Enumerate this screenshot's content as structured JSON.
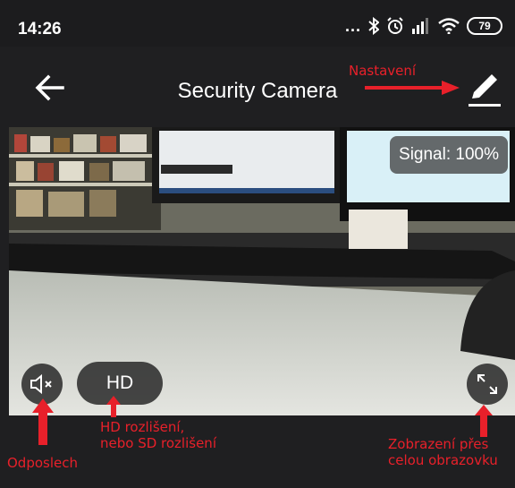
{
  "status_bar": {
    "time": "14:26",
    "dots": "...",
    "battery": "79",
    "icons": [
      "bluetooth-icon",
      "alarm-icon",
      "signal-bars-icon",
      "wifi-icon"
    ]
  },
  "header": {
    "title": "Security Camera",
    "back_icon": "arrow-left-icon",
    "edit_icon": "pencil-icon"
  },
  "video": {
    "signal_label": "Signal: 100%",
    "hd_label": "HD",
    "mute_icon": "speaker-muted-icon",
    "fullscreen_icon": "fullscreen-icon"
  },
  "annotations": {
    "settings": "Nastavení",
    "listen": "Odposlech",
    "hd_line1": "HD rozlišení,",
    "hd_line2": "nebo SD rozlišení",
    "fullscreen_line1": "Zobrazení přes",
    "fullscreen_line2": "celou obrazovku"
  },
  "colors": {
    "annotation_red": "#e8202a",
    "bar_background": "#1f1f21",
    "button_background": "#282828"
  }
}
